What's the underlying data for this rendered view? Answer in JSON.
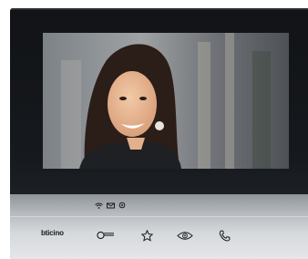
{
  "device": {
    "brand": "bticino",
    "status_icons": [
      "wifi-icon",
      "message-icon",
      "settings-icon"
    ],
    "buttons": [
      {
        "name": "door-key-button",
        "icon": "key-icon"
      },
      {
        "name": "favorites-button",
        "icon": "star-icon"
      },
      {
        "name": "camera-view-button",
        "icon": "eye-icon"
      },
      {
        "name": "answer-call-button",
        "icon": "phone-icon"
      }
    ]
  },
  "colors": {
    "frame": "#16191d",
    "panel": "#c9cdd1",
    "icon": "#1c1c1c"
  }
}
